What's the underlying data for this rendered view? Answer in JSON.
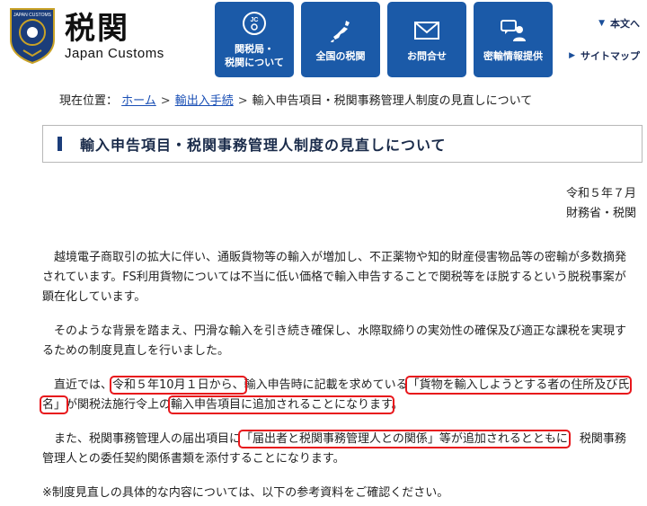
{
  "header": {
    "logo": {
      "kanji": "税関",
      "english": "Japan Customs",
      "emblem_text": "JAPAN CUSTOMS"
    },
    "nav_buttons": [
      {
        "label": "関税局・\n税関について",
        "icon": "jc-emblem-icon"
      },
      {
        "label": "全国の税関",
        "icon": "japan-map-icon"
      },
      {
        "label": "お問合せ",
        "icon": "mail-icon"
      },
      {
        "label": "密輸情報提供",
        "icon": "informant-icon"
      }
    ],
    "utility_links": [
      {
        "label": "本文へ"
      },
      {
        "label": "サイトマップ"
      }
    ],
    "accent_color": "#1b5aa8"
  },
  "breadcrumb": {
    "prefix": "現在位置：",
    "items": [
      "ホーム",
      "輸出入手続",
      "輸入申告項目・税関事務管理人制度の見直しについて"
    ],
    "separator": ">"
  },
  "page_title": "輸入申告項目・税関事務管理人制度の見直しについて",
  "date": {
    "line1": "令和５年７月",
    "line2": "財務省・税関"
  },
  "body": {
    "para1": "越境電子商取引の拡大に伴い、通販貨物等の輸入が増加し、不正薬物や知的財産侵害物品等の密輸が多数摘発されています。FS利用貨物については不当に低い価格で輸入申告することで関税等をほ脱するという脱税事案が顕在化しています。",
    "para2": "そのような背景を踏まえ、円滑な輸入を引き続き確保し、水際取締りの実効性の確保及び適正な課税を実現するための制度見直しを行いました。",
    "para3": {
      "t1": "直近では、",
      "h1": "令和５年10月１日から、",
      "t2": "輸入申告時に記載を求めている",
      "h2": "「貨物を輸入しようとする者の住所及び氏名」",
      "t3": "が関税法施行令上の",
      "h3": "輸入申告項目に追加されることになります",
      "t4": "。"
    },
    "para4": {
      "t1": "また、税関事務管理人の届出項目に",
      "h1": "「届出者と税関事務管理人との関係」等が追加されるとともに",
      "t2": "税関事務管理人との委任契約関係書類を添付することになります。"
    },
    "note": "※制度見直しの具体的な内容については、以下の参考資料をご確認ください。",
    "highlight_color": "#e8161b"
  }
}
